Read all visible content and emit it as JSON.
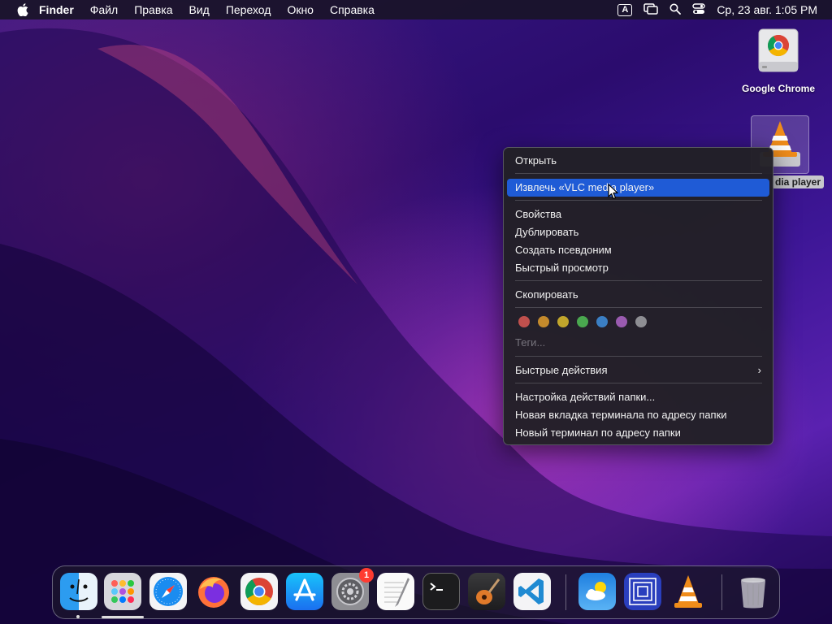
{
  "menubar": {
    "app_name": "Finder",
    "menus": [
      "Файл",
      "Правка",
      "Вид",
      "Переход",
      "Окно",
      "Справка"
    ],
    "input_source": "A",
    "clock": "Ср, 23 авг.  1:05 PM"
  },
  "desktop": {
    "chrome_label": "Google Chrome",
    "vlc_label": "dia player"
  },
  "context_menu": {
    "open": "Открыть",
    "eject": "Извлечь «VLC media player»",
    "properties": "Свойства",
    "duplicate": "Дублировать",
    "make_alias": "Создать псевдоним",
    "quick_look": "Быстрый просмотр",
    "copy": "Скопировать",
    "tag_colors": [
      "#c0504d",
      "#c48a2c",
      "#c2a62c",
      "#4aa84f",
      "#3b7fc4",
      "#9a5bb0",
      "#8e8e93"
    ],
    "tags": "Теги...",
    "quick_actions": "Быстрые действия",
    "quick_actions_arrow": "›",
    "folder_actions": "Настройка действий папки...",
    "new_terminal_tab": "Новая вкладка терминала по адресу папки",
    "new_terminal": "Новый терминал по адресу папки"
  },
  "dock": {
    "apps": [
      "finder-icon",
      "launchpad-icon",
      "safari-icon",
      "firefox-icon",
      "chrome-icon",
      "app-store-icon",
      "system-settings-icon",
      "textedit-icon",
      "terminal-icon",
      "garageband-icon",
      "vscode-icon",
      "weather-icon",
      "archive-utility-icon",
      "vlc-icon",
      "trash-icon"
    ],
    "settings_badge": "1"
  },
  "colors": {
    "highlight": "#1f5bd6",
    "menu_bg": "#222026"
  }
}
